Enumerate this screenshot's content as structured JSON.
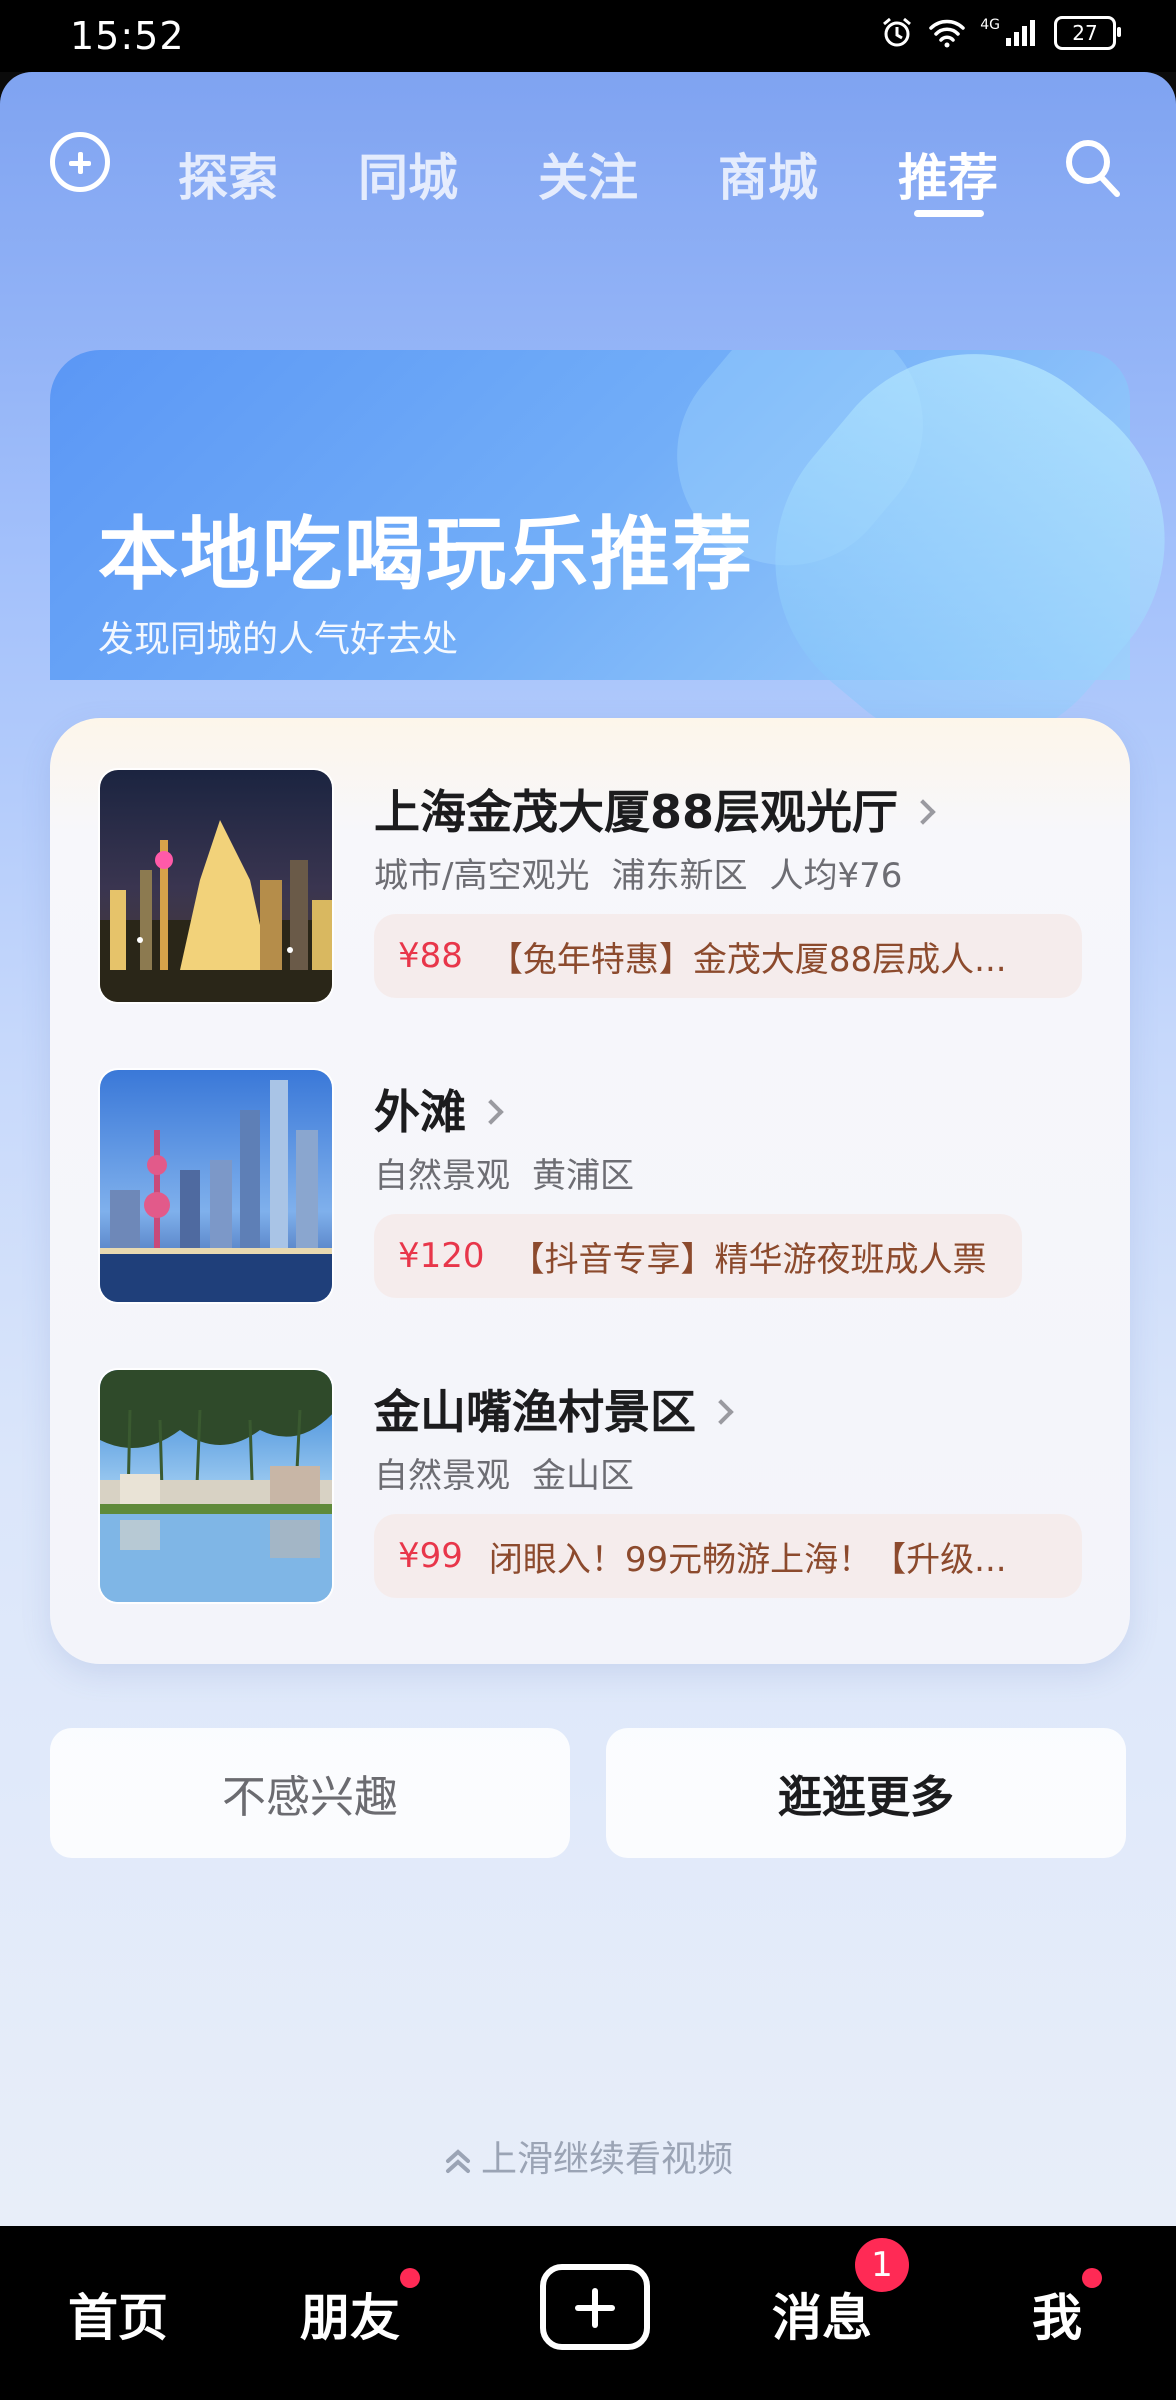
{
  "status": {
    "time": "15:52",
    "battery": "27",
    "network": "4G"
  },
  "topnav": {
    "tabs": [
      {
        "label": "探索"
      },
      {
        "label": "同城"
      },
      {
        "label": "关注"
      },
      {
        "label": "商城"
      },
      {
        "label": "推荐",
        "active": true
      }
    ]
  },
  "hero": {
    "title": "本地吃喝玩乐推荐",
    "subtitle": "发现同城的人气好去处"
  },
  "items": [
    {
      "name": "上海金茂大厦88层观光厅",
      "tags": [
        "城市/高空观光",
        "浦东新区",
        "人均¥76"
      ],
      "price": "¥88",
      "deal": "【兔年特惠】金茂大厦88层成人..."
    },
    {
      "name": "外滩",
      "tags": [
        "自然景观",
        "黄浦区"
      ],
      "price": "¥120",
      "deal": "【抖音专享】精华游夜班成人票"
    },
    {
      "name": "金山嘴渔村景区",
      "tags": [
        "自然景观",
        "金山区"
      ],
      "price": "¥99",
      "deal": "闭眼入！99元畅游上海！【升级..."
    }
  ],
  "buttons": {
    "not_interested": "不感兴趣",
    "explore_more": "逛逛更多"
  },
  "hint": "上滑继续看视频",
  "bottombar": {
    "home": "首页",
    "friends": "朋友",
    "messages": "消息",
    "messages_badge": "1",
    "me": "我"
  }
}
